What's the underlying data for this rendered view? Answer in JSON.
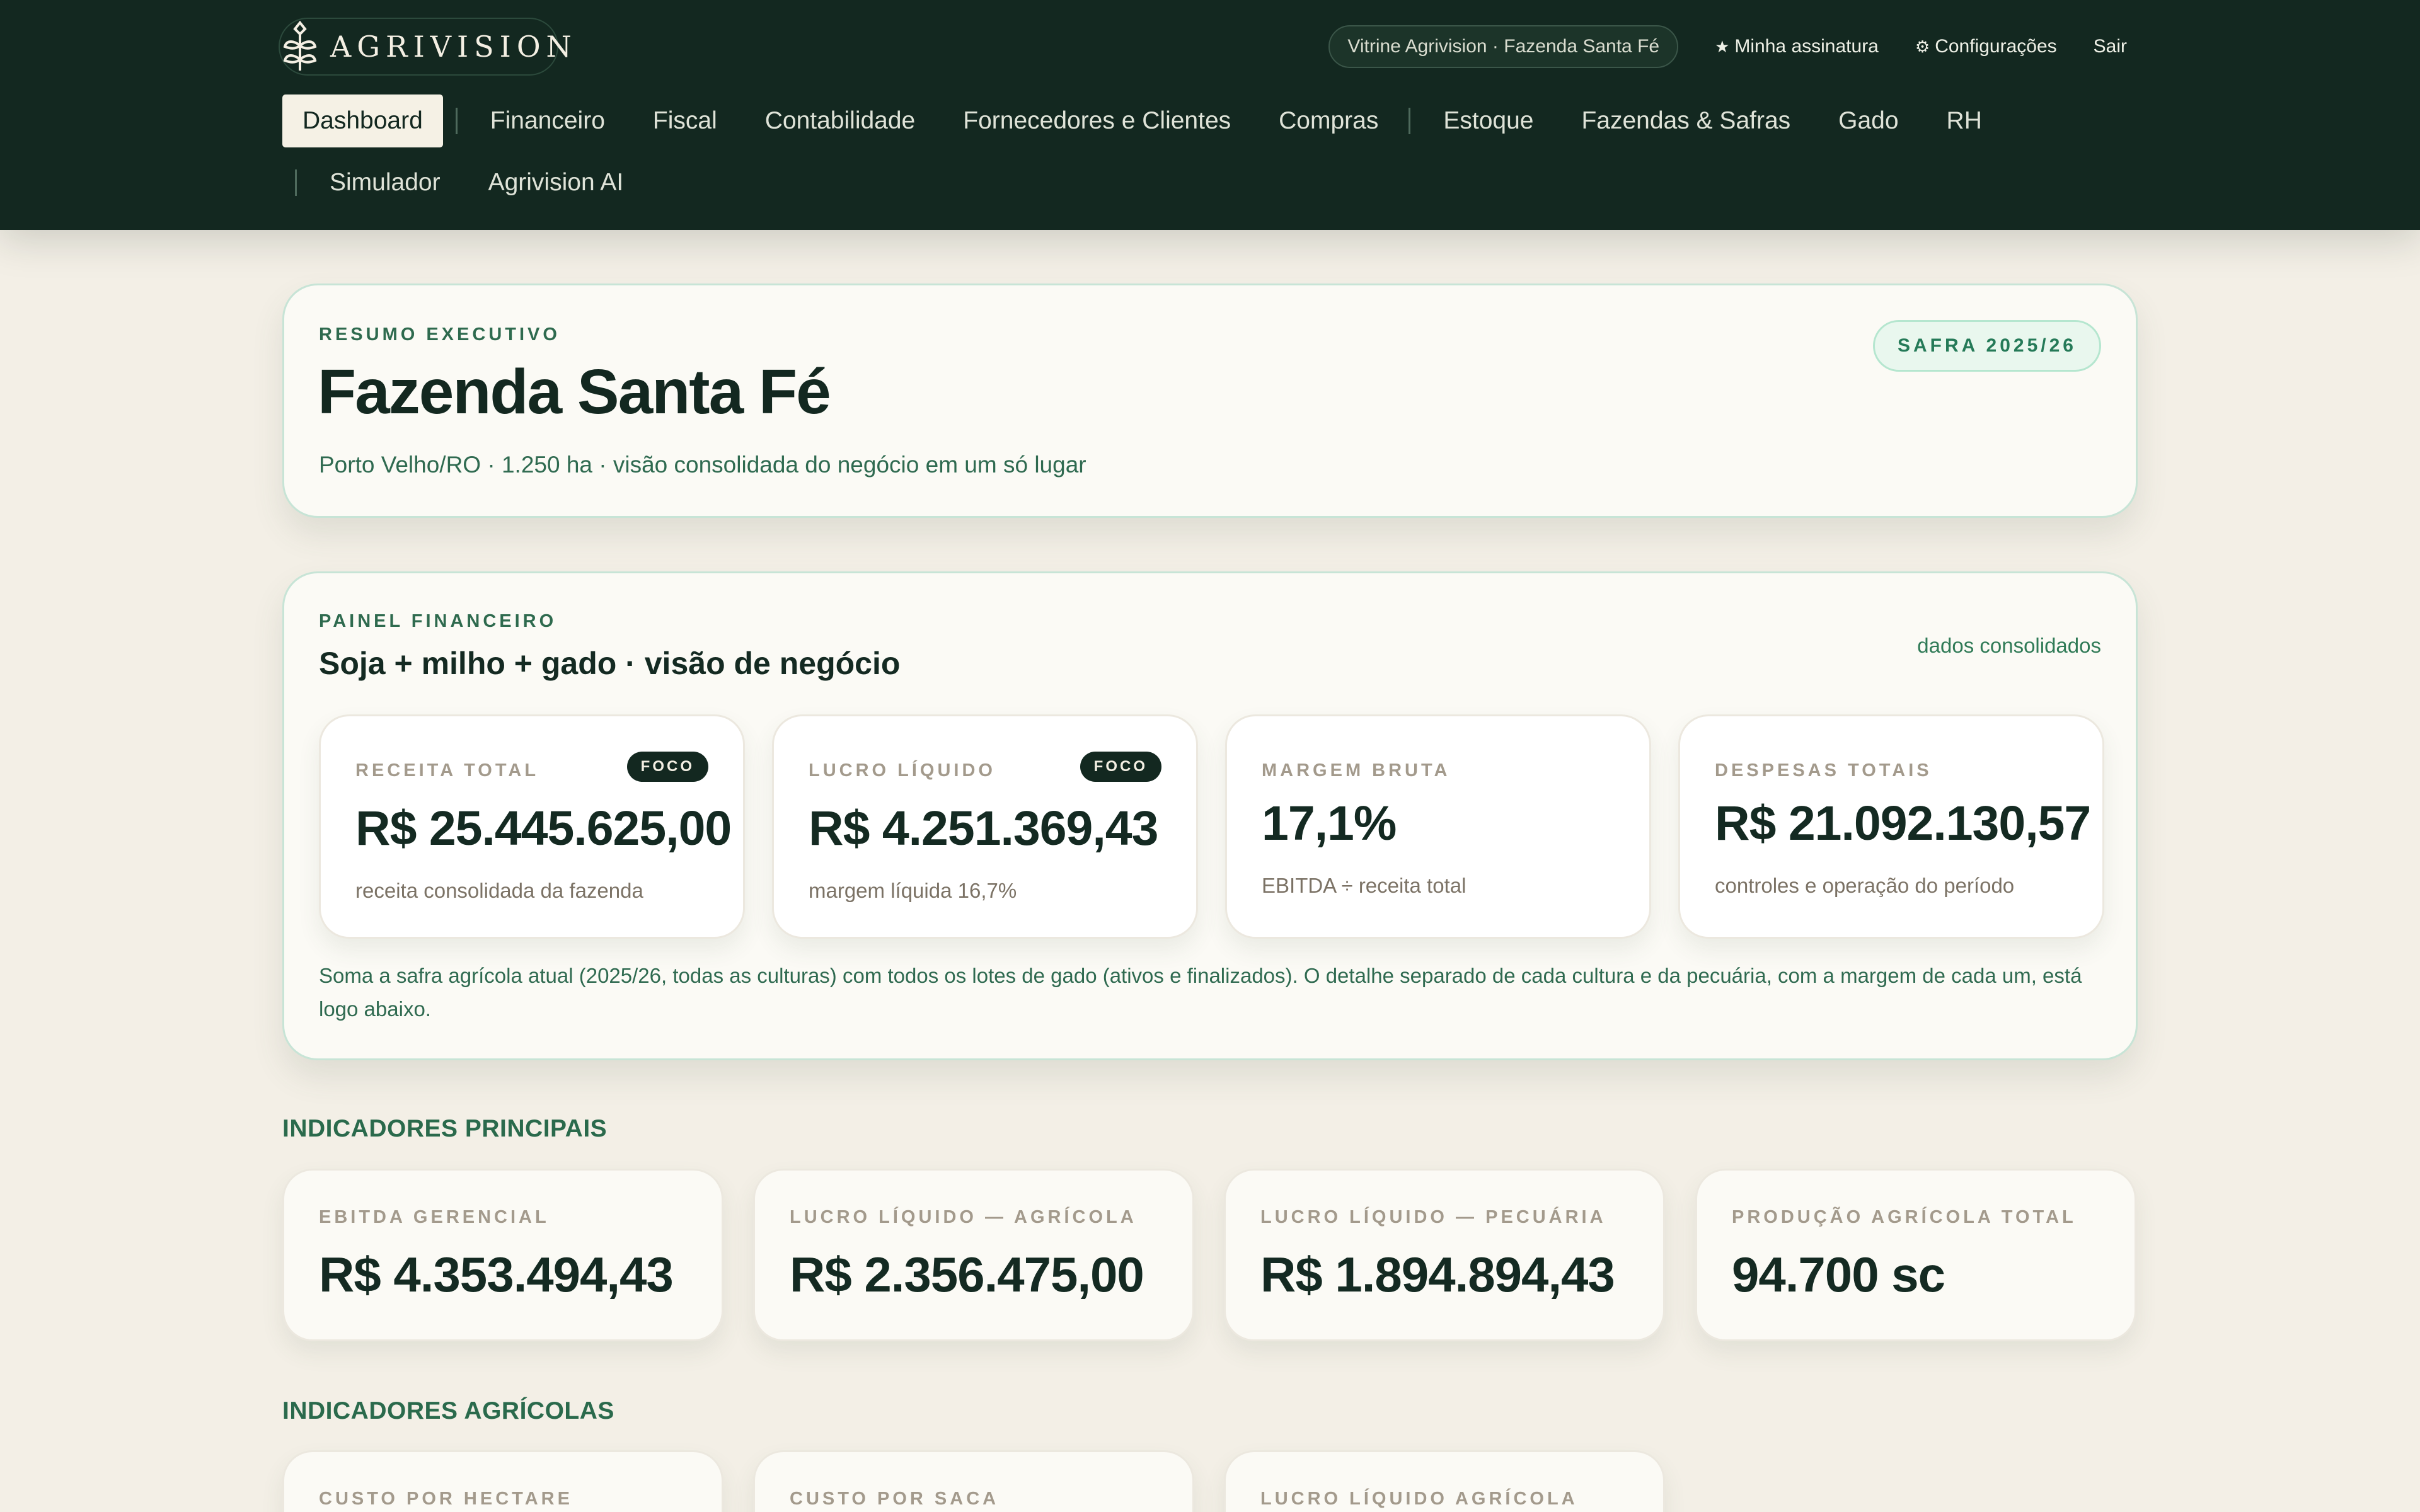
{
  "brand": {
    "name": "AGRIVISION"
  },
  "top": {
    "vitrine": "Vitrine Agrivision · Fazenda Santa Fé",
    "assinatura": "Minha assinatura",
    "configuracoes": "Configurações",
    "sair": "Sair"
  },
  "nav": {
    "row1": [
      "Dashboard",
      "Financeiro",
      "Fiscal",
      "Contabilidade",
      "Fornecedores e Clientes",
      "Compras",
      "Estoque",
      "Fazendas & Safras",
      "Gado",
      "RH"
    ],
    "row2": [
      "Simulador",
      "Agrivision AI"
    ]
  },
  "resumo": {
    "eyebrow": "RESUMO EXECUTIVO",
    "title": "Fazenda Santa Fé",
    "subtitle": "Porto Velho/RO · 1.250 ha · visão consolidada do negócio em um só lugar",
    "badge": "SAFRA 2025/26"
  },
  "painel": {
    "eyebrow": "PAINEL FINANCEIRO",
    "title": "Soja + milho + gado · visão de negócio",
    "dados": "dados consolidados",
    "kpis": [
      {
        "label": "RECEITA TOTAL",
        "tag": "FOCO",
        "value": "R$ 25.445.625,00",
        "note": "receita consolidada da fazenda"
      },
      {
        "label": "LUCRO LÍQUIDO",
        "tag": "FOCO",
        "value": "R$ 4.251.369,43",
        "note": "margem líquida 16,7%"
      },
      {
        "label": "MARGEM BRUTA",
        "tag": "",
        "value": "17,1%",
        "note": "EBITDA ÷ receita total"
      },
      {
        "label": "DESPESAS TOTAIS",
        "tag": "",
        "value": "R$ 21.092.130,57",
        "note": "controles e operação do período"
      }
    ],
    "footnote": "Soma a safra agrícola atual (2025/26, todas as culturas) com todos os lotes de gado (ativos e finalizados). O detalhe separado de cada cultura e da pecuária, com a margem de cada um, está logo abaixo."
  },
  "principais": {
    "title": "INDICADORES PRINCIPAIS",
    "items": [
      {
        "label": "EBITDA GERENCIAL",
        "value": "R$ 4.353.494,43"
      },
      {
        "label": "LUCRO LÍQUIDO — AGRÍCOLA",
        "value": "R$ 2.356.475,00"
      },
      {
        "label": "LUCRO LÍQUIDO — PECUÁRIA",
        "value": "R$ 1.894.894,43"
      },
      {
        "label": "PRODUÇÃO AGRÍCOLA TOTAL",
        "value": "94.700 sc"
      }
    ]
  },
  "agricolas": {
    "title": "INDICADORES AGRÍCOLAS",
    "items": [
      {
        "label": "CUSTO POR HECTARE"
      },
      {
        "label": "CUSTO POR SACA"
      },
      {
        "label": "LUCRO LÍQUIDO AGRÍCOLA"
      }
    ]
  }
}
